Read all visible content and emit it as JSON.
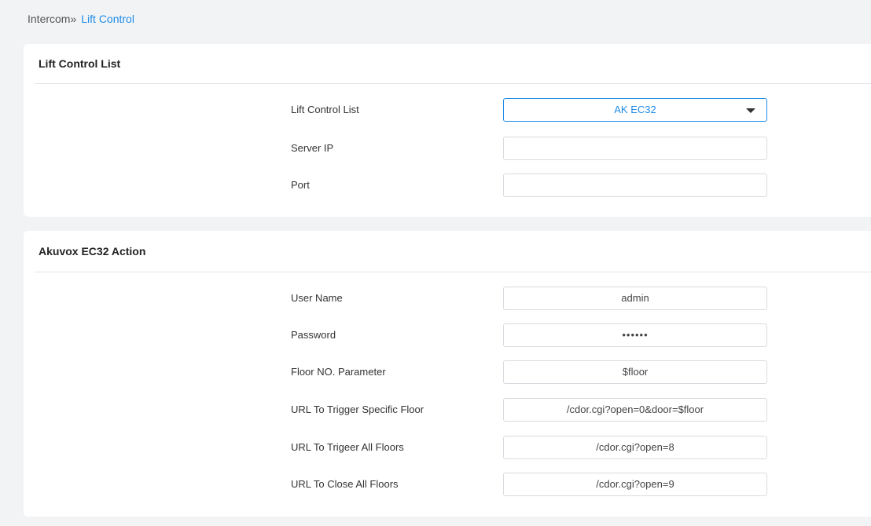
{
  "breadcrumb": {
    "root": "Intercom»",
    "current": "Lift Control"
  },
  "lift_control_section": {
    "title": "Lift Control List",
    "fields": [
      {
        "label": "Lift Control List",
        "value": "AK EC32"
      },
      {
        "label": "Server IP",
        "value": ""
      },
      {
        "label": "Port",
        "value": ""
      }
    ]
  },
  "action_section": {
    "title": "Akuvox EC32 Action",
    "fields": [
      {
        "label": "User Name",
        "value": "admin"
      },
      {
        "label": "Password",
        "value": "••••••"
      },
      {
        "label": "Floor NO. Parameter",
        "value": "$floor"
      },
      {
        "label": "URL To Trigger Specific Floor",
        "value": "/cdor.cgi?open=0&door=$floor"
      },
      {
        "label": "URL To Trigeer All Floors",
        "value": "/cdor.cgi?open=8"
      },
      {
        "label": "URL To Close All Floors",
        "value": "/cdor.cgi?open=9"
      }
    ]
  },
  "icons": {
    "select_caret": "caret-down-icon"
  },
  "colors": {
    "accent": "#1f8ce8",
    "background": "#f2f3f5",
    "panel": "#ffffff"
  }
}
